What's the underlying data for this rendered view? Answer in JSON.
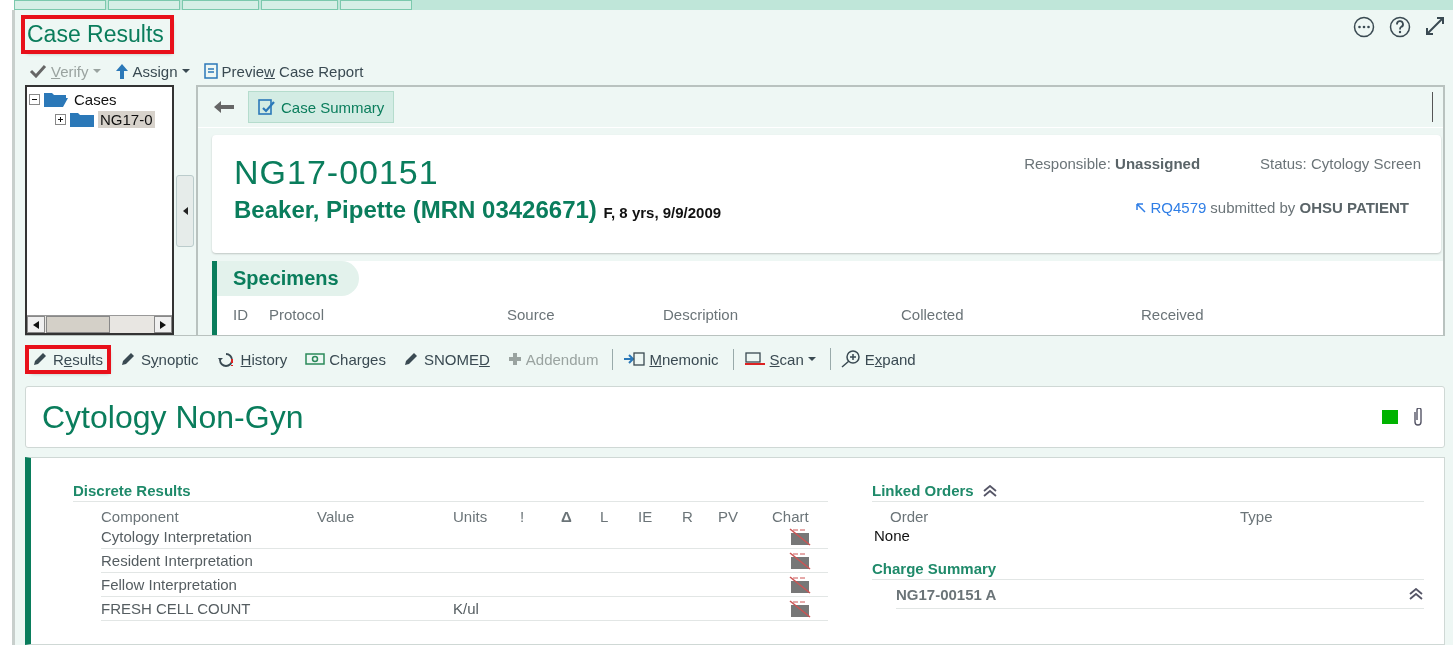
{
  "title": {
    "text": "Case Results",
    "highlighted": true
  },
  "toolbar": [
    {
      "kind": "check",
      "key": "V",
      "after": "erify",
      "disabled": true,
      "dropdown": true
    },
    {
      "kind": "up",
      "before": "Assign",
      "disabled": false,
      "dropdown": true
    },
    {
      "kind": "report",
      "before": "Previe",
      "key": "w",
      "after": " Case Report",
      "disabled": false,
      "dropdown": false
    }
  ],
  "tree": {
    "items": [
      {
        "label": "Cases",
        "expanded": true,
        "selected": false,
        "children": [
          {
            "label": "NG17-0",
            "expanded": false,
            "selected": true
          }
        ]
      }
    ]
  },
  "case_summary_button": {
    "label": "Case Summary",
    "selected": true
  },
  "case": {
    "number": "NG17-00151",
    "patient": "Beaker, Pipette (MRN 03426671)",
    "demographics": "F, 8 yrs, 9/9/2009",
    "responsible": "Responsible: **Unassigned**",
    "status": "Status: Cytology Screen",
    "request_link": "RQ4579",
    "submitted": "submitted by **OHSU PATIENT**"
  },
  "specimens": {
    "title": "Specimens",
    "columns": [
      "ID",
      "Protocol",
      "Source",
      "Description",
      "Collected",
      "Received"
    ]
  },
  "activity_toolbar": [
    {
      "kind": "pencil",
      "before": "R",
      "key": "e",
      "after": "sults",
      "highlighted": true,
      "disabled": false,
      "separator_before": false,
      "dropdown": false
    },
    {
      "kind": "pencil",
      "before": "S",
      "key": "y",
      "after": "noptic",
      "highlighted": false,
      "disabled": false,
      "separator_before": false,
      "dropdown": false
    },
    {
      "kind": "history",
      "key": "H",
      "after": "istory",
      "highlighted": false,
      "disabled": false,
      "separator_before": false,
      "dropdown": false
    },
    {
      "kind": "money",
      "before": "Charges",
      "highlighted": false,
      "disabled": false,
      "separator_before": false,
      "dropdown": false
    },
    {
      "kind": "pencil",
      "before": "SNOME",
      "key": "D",
      "highlighted": false,
      "disabled": false,
      "separator_before": false,
      "dropdown": false
    },
    {
      "kind": "plus",
      "before": "Addendum",
      "highlighted": false,
      "disabled": true,
      "separator_before": false,
      "dropdown": false
    },
    {
      "kind": "import",
      "key": "M",
      "after": "nemonic",
      "highlighted": false,
      "disabled": false,
      "separator_before": true,
      "dropdown": false
    },
    {
      "kind": "scan",
      "key": "S",
      "after": "can",
      "highlighted": false,
      "disabled": false,
      "separator_before": true,
      "dropdown": true
    },
    {
      "kind": "zoom",
      "before": "E",
      "key": "x",
      "after": "pand",
      "highlighted": false,
      "disabled": false,
      "separator_before": true,
      "dropdown": false
    }
  ],
  "report": {
    "title": "Cytology Non-Gyn",
    "color": "#00b300"
  },
  "discrete_results": {
    "title": "Discrete Results",
    "columns": [
      "Component",
      "Value",
      "Units",
      "!",
      "Δ",
      "L",
      "IE",
      "R",
      "PV",
      "Chart"
    ],
    "rows": [
      {
        "component": "Cytology Interpretation"
      },
      {
        "component": "Resident Interpretation"
      },
      {
        "component": "Fellow Interpretation"
      },
      {
        "component": "FRESH CELL COUNT",
        "units": "K/ul"
      }
    ]
  },
  "linked_orders": {
    "title": "Linked Orders",
    "expanded": true,
    "columns": [
      "Order",
      "Type"
    ],
    "empty_text": "None"
  },
  "charge_summary": {
    "title": "Charge Summary",
    "items": [
      {
        "label": "NG17-00151 A",
        "expanded": true
      }
    ]
  }
}
